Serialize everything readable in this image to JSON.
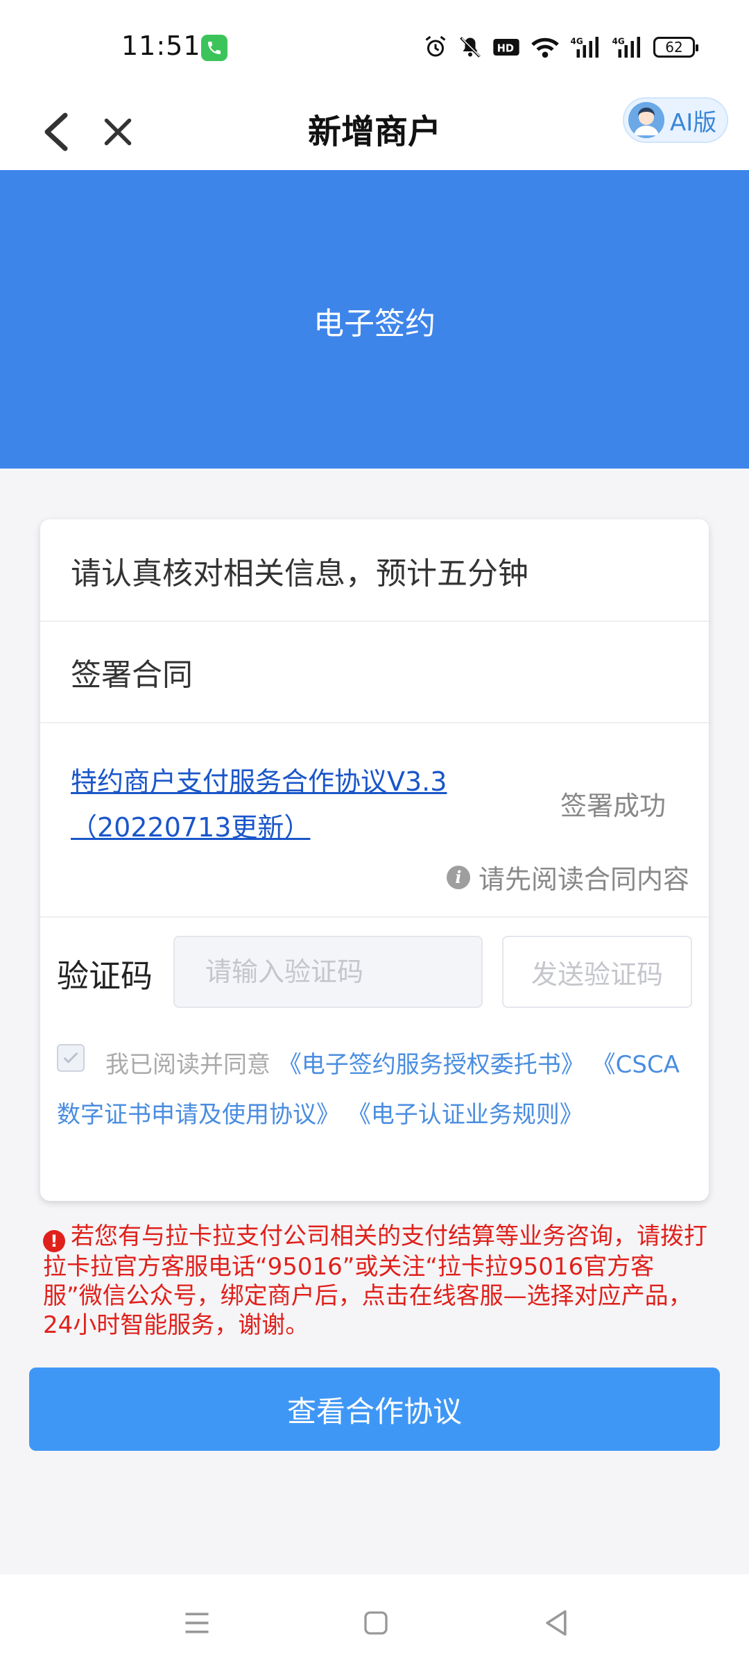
{
  "status_bar": {
    "time": "11:51",
    "battery": "62",
    "icons": [
      "phone-icon",
      "alarm-icon",
      "mute-icon",
      "hd-icon",
      "wifi-icon",
      "signal-4g-icon",
      "signal-4g-icon",
      "battery-icon"
    ]
  },
  "nav": {
    "title": "新增商户",
    "ai_label": "AI版"
  },
  "banner": {
    "title": "电子签约"
  },
  "card": {
    "notice": "请认真核对相关信息，预计五分钟",
    "section_title": "签署合同",
    "contract_link": "特约商户支付服务合作协议V3.3（20220713更新）",
    "sign_status": "签署成功",
    "read_hint": "请先阅读合同内容",
    "code_label": "验证码",
    "code_placeholder": "请输入验证码",
    "send_code": "发送验证码",
    "agree_prefix": "我已阅读并同意",
    "agree_links": [
      "《电子签约服务授权委托书》",
      "《CSCA数字证书申请及使用协议》",
      "《电子认证业务规则》"
    ]
  },
  "notice": {
    "text": "若您有与拉卡拉支付公司相关的支付结算等业务咨询，请拨打拉卡拉官方客服电话“95016”或关注“拉卡拉95016官方客服”微信公众号，绑定商户后，点击在线客服—选择对应产品，24小时智能服务，谢谢。"
  },
  "primary_button": {
    "label": "查看合作协议"
  },
  "colors": {
    "banner": "#3e85ea",
    "button": "#3f97f5",
    "link": "#1a56c9",
    "notice_red": "#e0201b"
  }
}
